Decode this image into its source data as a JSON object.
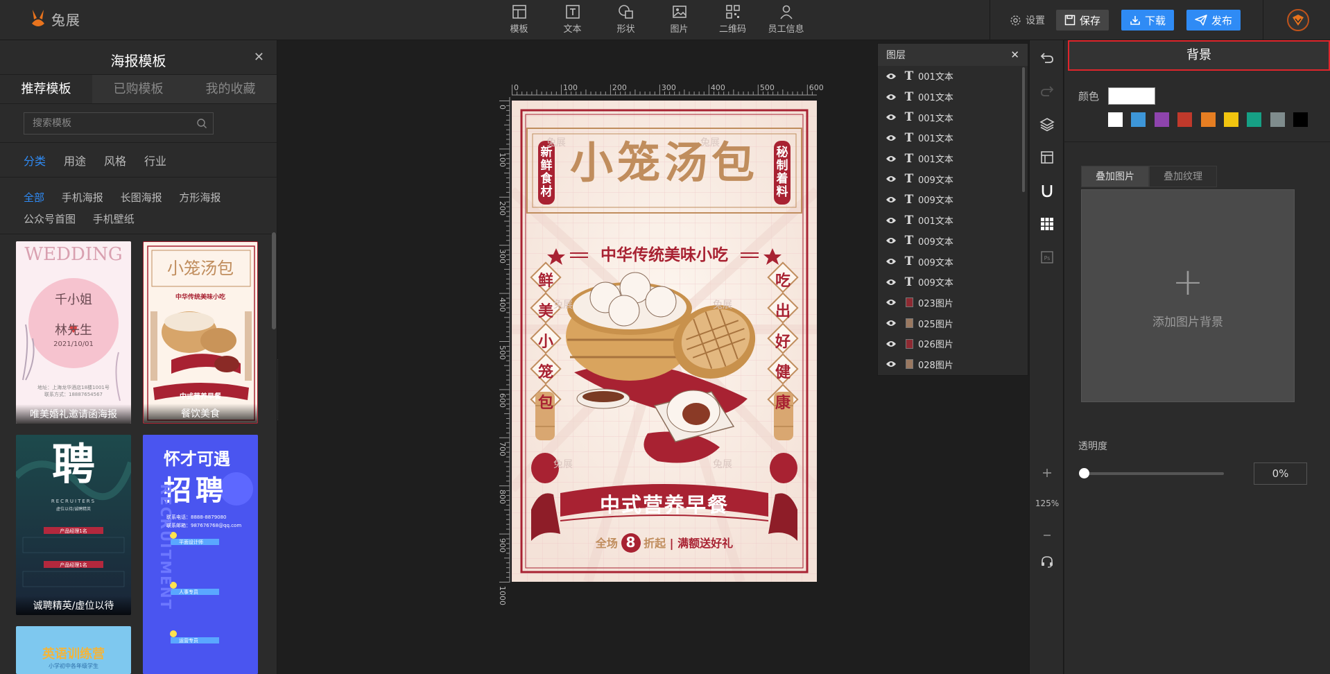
{
  "brand": {
    "name": "兔展"
  },
  "toolbar": {
    "tools": [
      {
        "label": "模板",
        "icon": "template-icon"
      },
      {
        "label": "文本",
        "icon": "text-icon"
      },
      {
        "label": "形状",
        "icon": "shape-icon"
      },
      {
        "label": "图片",
        "icon": "image-icon"
      },
      {
        "label": "二维码",
        "icon": "qrcode-icon"
      },
      {
        "label": "员工信息",
        "icon": "user-icon"
      }
    ],
    "settings_label": "设置",
    "save_label": "保存",
    "download_label": "下载",
    "publish_label": "发布"
  },
  "left_panel": {
    "title": "海报模板",
    "tabs": [
      "推荐模板",
      "已购模板",
      "我的收藏"
    ],
    "search_placeholder": "搜索模板",
    "categories": [
      "分类",
      "用途",
      "风格",
      "行业"
    ],
    "subcategories": [
      "全部",
      "手机海报",
      "长图海报",
      "方形海报",
      "公众号首图",
      "手机壁纸"
    ],
    "templates": [
      {
        "caption": "唯美婚礼邀请函海报",
        "heading": "WEDDING",
        "names": "千小姐",
        "names2": "林先生",
        "date": "2021/10/01",
        "addr": "地址：上海龙华酒店18楼1001号",
        "tel": "联系方式：18887654567"
      },
      {
        "caption": "餐饮美食",
        "heading": "小笼汤包",
        "sub": "中华传统美味小吃",
        "banner": "中式营养早餐"
      },
      {
        "caption": "诚聘精英/虚位以待",
        "heading": "聘",
        "sub": "RECRUITERS",
        "sub2": "虚位以待/诚聘精英",
        "job": "产品经理1名"
      },
      {
        "heading1": "怀才可遇",
        "heading2": "招聘",
        "side": "RECRUITMENT",
        "tel": "联系电话：8888-8879080",
        "mail": "联系邮箱：987676768@qq.com",
        "jobs": [
          "平面设计师",
          "人事专员",
          "运营专员"
        ]
      },
      {
        "heading": "英语训练营",
        "sub": "小学初中各年级学生"
      }
    ]
  },
  "poster": {
    "title": "小笼汤包",
    "left_tag": "新鲜食材",
    "right_tag": "秘制着料",
    "subtitle": "中华传统美味小吃",
    "left_col": [
      "鲜",
      "美",
      "小",
      "笼",
      "包"
    ],
    "right_col": [
      "吃",
      "出",
      "好",
      "健",
      "康"
    ],
    "banner": "中式营养早餐",
    "promo_prefix": "全场",
    "promo_num": "8",
    "promo_suffix": "折起",
    "promo_extra": "满额送好礼",
    "watermark": "兔展"
  },
  "rulers": {
    "h": [
      "0",
      "100",
      "200",
      "300",
      "400",
      "500",
      "600"
    ],
    "v": [
      "0",
      "100",
      "200",
      "300",
      "400",
      "500",
      "600",
      "700",
      "800",
      "900",
      "1000"
    ]
  },
  "layers": {
    "title": "图层",
    "items": [
      {
        "name": "001文本",
        "kind": "text"
      },
      {
        "name": "001文本",
        "kind": "text"
      },
      {
        "name": "001文本",
        "kind": "text"
      },
      {
        "name": "001文本",
        "kind": "text"
      },
      {
        "name": "001文本",
        "kind": "text"
      },
      {
        "name": "009文本",
        "kind": "text"
      },
      {
        "name": "009文本",
        "kind": "text"
      },
      {
        "name": "001文本",
        "kind": "text"
      },
      {
        "name": "009文本",
        "kind": "text"
      },
      {
        "name": "009文本",
        "kind": "text"
      },
      {
        "name": "009文本",
        "kind": "text"
      },
      {
        "name": "023图片",
        "kind": "image",
        "color": "#8e2a32"
      },
      {
        "name": "025图片",
        "kind": "image",
        "color": "#9a7860"
      },
      {
        "name": "026图片",
        "kind": "image",
        "color": "#8e2a32"
      },
      {
        "name": "028图片",
        "kind": "image",
        "color": "#9a7860"
      }
    ]
  },
  "zoom": "125%",
  "right_panel": {
    "title": "背景",
    "color_label": "颜色",
    "current_color": "#ffffff",
    "swatches": [
      "#ffffff",
      "#3d96d8",
      "#8e44ad",
      "#c0392b",
      "#e67e22",
      "#f1c40f",
      "#16a085",
      "#7f8c8d",
      "#000000"
    ],
    "overlay_tabs": [
      "叠加图片",
      "叠加纹理"
    ],
    "add_image_label": "添加图片背景",
    "opacity_label": "透明度",
    "opacity_value": "0%"
  },
  "theme": {
    "accent": "#2f8bf5",
    "poster_red": "#a82232",
    "poster_tan": "#c08d5d"
  }
}
